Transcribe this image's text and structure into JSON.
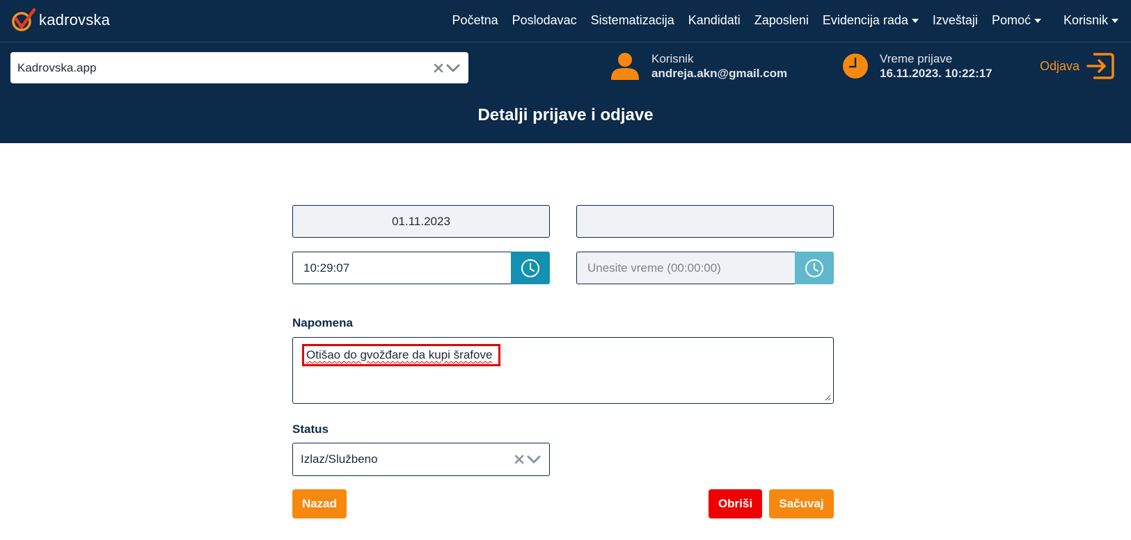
{
  "app": {
    "name": "kadrovska"
  },
  "nav": {
    "items": [
      "Početna",
      "Poslodavac",
      "Sistematizacija",
      "Kandidati",
      "Zaposleni"
    ],
    "evidencija": "Evidencija rada",
    "izvestaji": "Izveštaji",
    "pomoc": "Pomoć",
    "korisnik": "Korisnik"
  },
  "company": {
    "selected": "Kadrovska.app"
  },
  "user_info": {
    "label": "Korisnik",
    "email": "andreja.akn@gmail.com"
  },
  "login_info": {
    "label": "Vreme prijave",
    "time": "16.11.2023. 10:22:17"
  },
  "logout": {
    "label": "Odjava"
  },
  "page": {
    "title": "Detalji prijave i odjave"
  },
  "form": {
    "date_in": "01.11.2023",
    "date_out": "",
    "time_in": "10:29:07",
    "time_out_placeholder": "Unesite vreme (00:00:00)",
    "note_label": "Napomena",
    "note_value": "Otišao do gvožđare da kupi šrafove",
    "status_label": "Status",
    "status_value": "Izlaz/Službeno"
  },
  "buttons": {
    "back": "Nazad",
    "delete": "Obriši",
    "save": "Sačuvaj"
  },
  "colors": {
    "header": "#0c2a49",
    "accent": "#f7880f",
    "danger": "#f00000",
    "info": "#1491b0"
  },
  "icons": {
    "logo": "check-logo-icon",
    "user": "user-icon",
    "clock": "clock-icon",
    "logout": "logout-icon",
    "clear": "clear-icon",
    "dropdown": "chevron-down-icon"
  }
}
